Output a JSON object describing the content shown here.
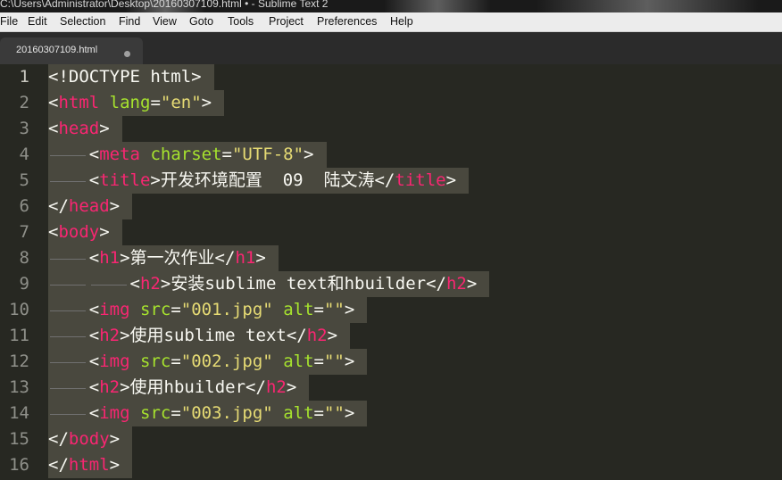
{
  "window": {
    "title": "C:\\Users\\Administrator\\Desktop\\20160307109.html • - Sublime Text 2"
  },
  "menu": {
    "items": [
      "File",
      "Edit",
      "Selection",
      "Find",
      "View",
      "Goto",
      "Tools",
      "Project",
      "Preferences",
      "Help"
    ]
  },
  "tab": {
    "label": "20160307109.html",
    "modified_indicator": "●"
  },
  "editor": {
    "current_line": 1,
    "line_numbers": [
      "1",
      "2",
      "3",
      "4",
      "5",
      "6",
      "7",
      "8",
      "9",
      "10",
      "11",
      "12",
      "13",
      "14",
      "15",
      "16"
    ],
    "lines": [
      {
        "indent": 0,
        "tokens": [
          {
            "c": "p",
            "t": "<!DOCTYPE html>"
          }
        ]
      },
      {
        "indent": 0,
        "tokens": [
          {
            "c": "p",
            "t": "<"
          },
          {
            "c": "tag",
            "t": "html"
          },
          {
            "c": "p",
            "t": " "
          },
          {
            "c": "attr",
            "t": "lang"
          },
          {
            "c": "p",
            "t": "="
          },
          {
            "c": "str",
            "t": "\"en\""
          },
          {
            "c": "p",
            "t": ">"
          }
        ]
      },
      {
        "indent": 0,
        "tokens": [
          {
            "c": "p",
            "t": "<"
          },
          {
            "c": "tag",
            "t": "head"
          },
          {
            "c": "p",
            "t": ">"
          }
        ]
      },
      {
        "indent": 1,
        "tokens": [
          {
            "c": "p",
            "t": "<"
          },
          {
            "c": "tag",
            "t": "meta"
          },
          {
            "c": "p",
            "t": " "
          },
          {
            "c": "attr",
            "t": "charset"
          },
          {
            "c": "p",
            "t": "="
          },
          {
            "c": "str",
            "t": "\"UTF-8\""
          },
          {
            "c": "p",
            "t": ">"
          }
        ]
      },
      {
        "indent": 1,
        "tokens": [
          {
            "c": "p",
            "t": "<"
          },
          {
            "c": "tag",
            "t": "title"
          },
          {
            "c": "p",
            "t": ">开发环境配置  09  陆文涛</"
          },
          {
            "c": "tag",
            "t": "title"
          },
          {
            "c": "p",
            "t": ">"
          }
        ]
      },
      {
        "indent": 0,
        "tokens": [
          {
            "c": "p",
            "t": "</"
          },
          {
            "c": "tag",
            "t": "head"
          },
          {
            "c": "p",
            "t": ">"
          }
        ]
      },
      {
        "indent": 0,
        "tokens": [
          {
            "c": "p",
            "t": "<"
          },
          {
            "c": "tag",
            "t": "body"
          },
          {
            "c": "p",
            "t": ">"
          }
        ]
      },
      {
        "indent": 1,
        "tokens": [
          {
            "c": "p",
            "t": "<"
          },
          {
            "c": "tag",
            "t": "h1"
          },
          {
            "c": "p",
            "t": ">第一次作业</"
          },
          {
            "c": "tag",
            "t": "h1"
          },
          {
            "c": "p",
            "t": ">"
          }
        ]
      },
      {
        "indent": 2,
        "tokens": [
          {
            "c": "p",
            "t": "<"
          },
          {
            "c": "tag",
            "t": "h2"
          },
          {
            "c": "p",
            "t": ">安装sublime text和hbuilder</"
          },
          {
            "c": "tag",
            "t": "h2"
          },
          {
            "c": "p",
            "t": ">"
          }
        ]
      },
      {
        "indent": 1,
        "tokens": [
          {
            "c": "p",
            "t": "<"
          },
          {
            "c": "tag",
            "t": "img"
          },
          {
            "c": "p",
            "t": " "
          },
          {
            "c": "attr",
            "t": "src"
          },
          {
            "c": "p",
            "t": "="
          },
          {
            "c": "str",
            "t": "\"001.jpg\""
          },
          {
            "c": "p",
            "t": " "
          },
          {
            "c": "attr",
            "t": "alt"
          },
          {
            "c": "p",
            "t": "="
          },
          {
            "c": "str",
            "t": "\"\""
          },
          {
            "c": "p",
            "t": ">"
          }
        ]
      },
      {
        "indent": 1,
        "tokens": [
          {
            "c": "p",
            "t": "<"
          },
          {
            "c": "tag",
            "t": "h2"
          },
          {
            "c": "p",
            "t": ">使用sublime text</"
          },
          {
            "c": "tag",
            "t": "h2"
          },
          {
            "c": "p",
            "t": ">"
          }
        ]
      },
      {
        "indent": 1,
        "tokens": [
          {
            "c": "p",
            "t": "<"
          },
          {
            "c": "tag",
            "t": "img"
          },
          {
            "c": "p",
            "t": " "
          },
          {
            "c": "attr",
            "t": "src"
          },
          {
            "c": "p",
            "t": "="
          },
          {
            "c": "str",
            "t": "\"002.jpg\""
          },
          {
            "c": "p",
            "t": " "
          },
          {
            "c": "attr",
            "t": "alt"
          },
          {
            "c": "p",
            "t": "="
          },
          {
            "c": "str",
            "t": "\"\""
          },
          {
            "c": "p",
            "t": ">"
          }
        ]
      },
      {
        "indent": 1,
        "tokens": [
          {
            "c": "p",
            "t": "<"
          },
          {
            "c": "tag",
            "t": "h2"
          },
          {
            "c": "p",
            "t": ">使用hbuilder</"
          },
          {
            "c": "tag",
            "t": "h2"
          },
          {
            "c": "p",
            "t": ">"
          }
        ]
      },
      {
        "indent": 1,
        "tokens": [
          {
            "c": "p",
            "t": "<"
          },
          {
            "c": "tag",
            "t": "img"
          },
          {
            "c": "p",
            "t": " "
          },
          {
            "c": "attr",
            "t": "src"
          },
          {
            "c": "p",
            "t": "="
          },
          {
            "c": "str",
            "t": "\"003.jpg\""
          },
          {
            "c": "p",
            "t": " "
          },
          {
            "c": "attr",
            "t": "alt"
          },
          {
            "c": "p",
            "t": "="
          },
          {
            "c": "str",
            "t": "\"\""
          },
          {
            "c": "p",
            "t": ">"
          }
        ]
      },
      {
        "indent": 0,
        "tokens": [
          {
            "c": "p",
            "t": "</"
          },
          {
            "c": "tag",
            "t": "body"
          },
          {
            "c": "p",
            "t": ">"
          }
        ]
      },
      {
        "indent": 0,
        "tokens": [
          {
            "c": "p",
            "t": "</"
          },
          {
            "c": "tag",
            "t": "html"
          },
          {
            "c": "p",
            "t": ">"
          }
        ]
      }
    ]
  },
  "colors": {
    "background": "#272822",
    "selection": "#49483e",
    "tag": "#f92672",
    "attribute": "#a6e22e",
    "string": "#e6db74",
    "plain": "#f8f8f2",
    "gutter_text": "#8f908a"
  }
}
